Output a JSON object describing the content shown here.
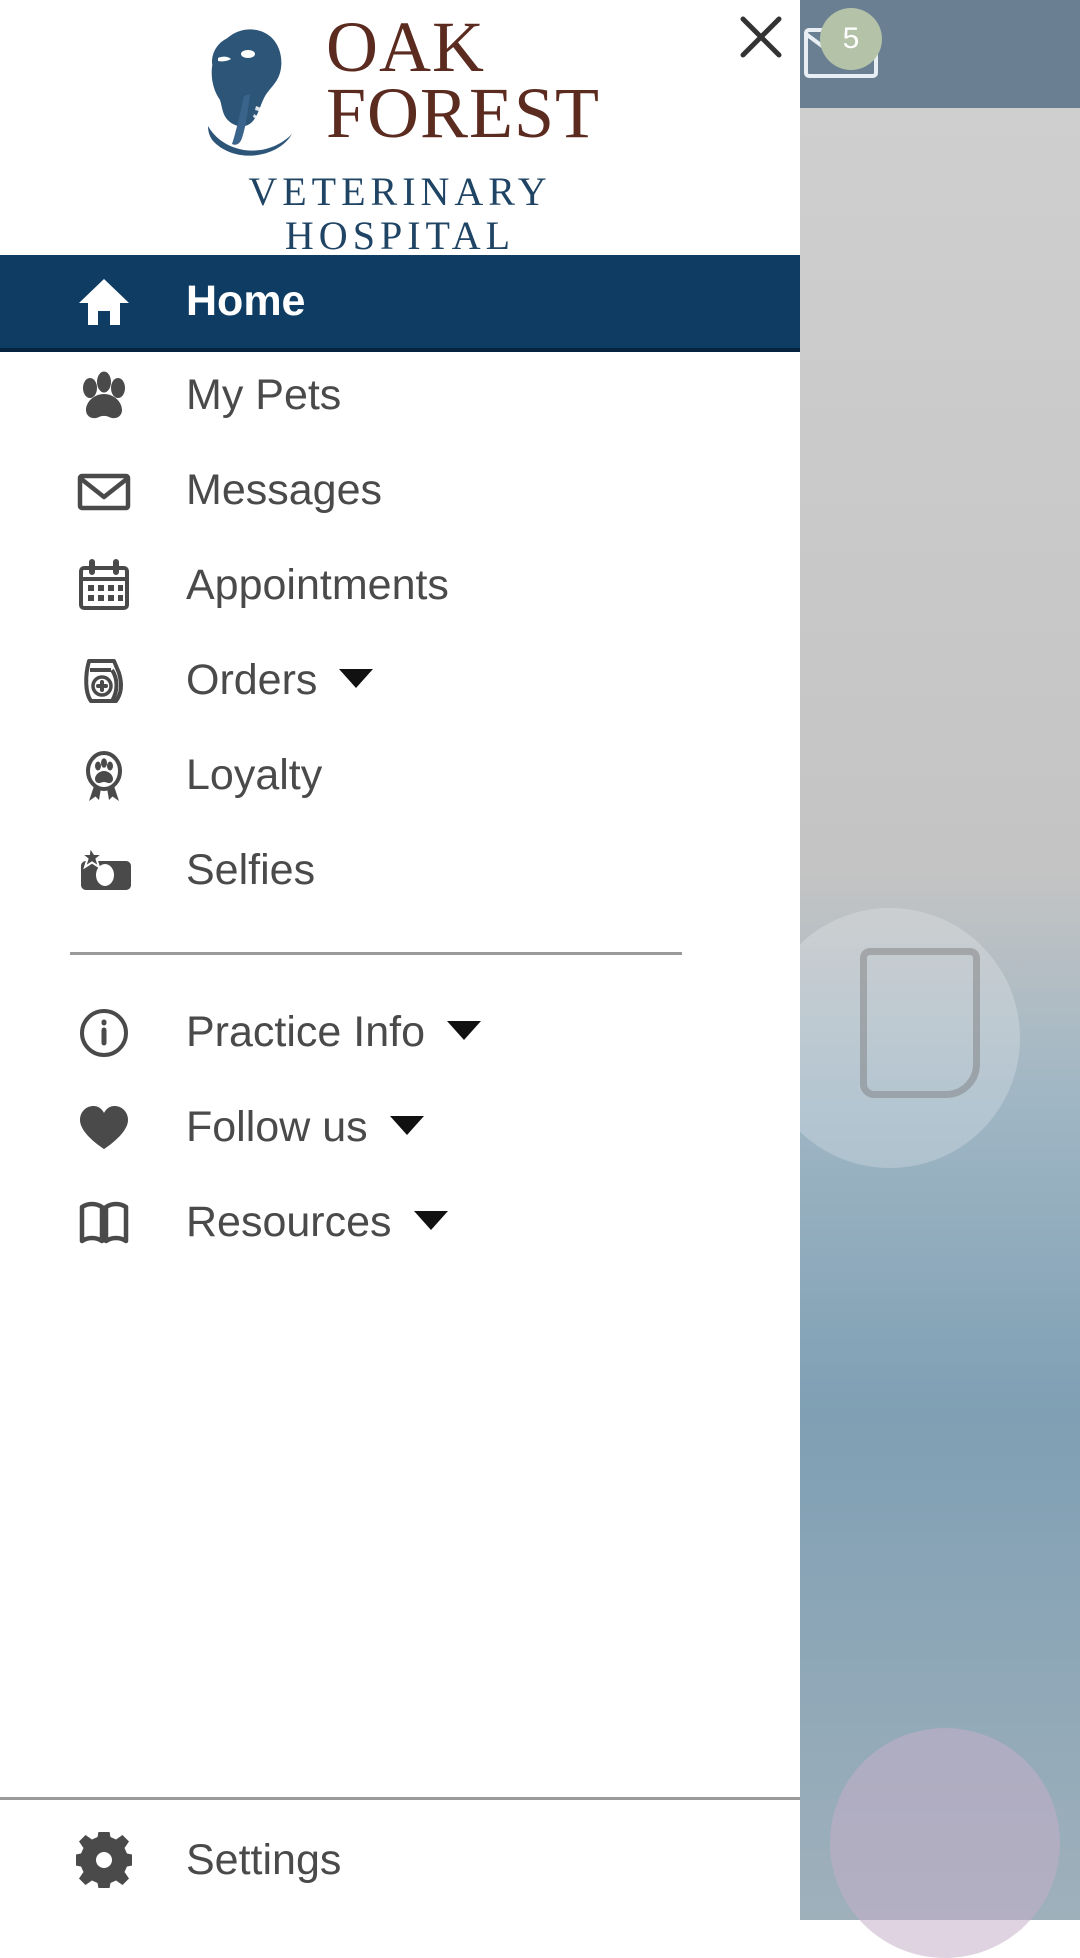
{
  "background": {
    "badge_count": "5",
    "mail_icon": "mail-icon"
  },
  "close_button": {
    "icon": "close-icon",
    "label": "Close"
  },
  "logo": {
    "line1": "OAK",
    "line2": "FOREST",
    "sub1": "VETERINARY",
    "sub2": "HOSPITAL",
    "mark": "dog-head-icon",
    "word_color": "#5c2b20",
    "sub_color": "#1f4464"
  },
  "colors": {
    "active_background": "#0e3c63",
    "active_text": "#ffffff",
    "item_text": "#4a4a4a",
    "divider": "#9a9a9a",
    "drawer_background": "#ffffff"
  },
  "nav": {
    "primary": [
      {
        "label": "Home",
        "icon": "home-icon",
        "active": true,
        "expandable": false
      },
      {
        "label": "My Pets",
        "icon": "paw-icon",
        "active": false,
        "expandable": false
      },
      {
        "label": "Messages",
        "icon": "envelope-icon",
        "active": false,
        "expandable": false
      },
      {
        "label": "Appointments",
        "icon": "calendar-icon",
        "active": false,
        "expandable": false
      },
      {
        "label": "Orders",
        "icon": "food-bag-icon",
        "active": false,
        "expandable": true
      },
      {
        "label": "Loyalty",
        "icon": "award-paw-icon",
        "active": false,
        "expandable": false
      },
      {
        "label": "Selfies",
        "icon": "camera-star-icon",
        "active": false,
        "expandable": false
      }
    ],
    "secondary": [
      {
        "label": "Practice Info",
        "icon": "info-circle-icon",
        "active": false,
        "expandable": true
      },
      {
        "label": "Follow us",
        "icon": "heart-icon",
        "active": false,
        "expandable": true
      },
      {
        "label": "Resources",
        "icon": "book-icon",
        "active": false,
        "expandable": true
      }
    ],
    "footer": [
      {
        "label": "Settings",
        "icon": "gear-icon",
        "active": false,
        "expandable": false
      }
    ]
  }
}
